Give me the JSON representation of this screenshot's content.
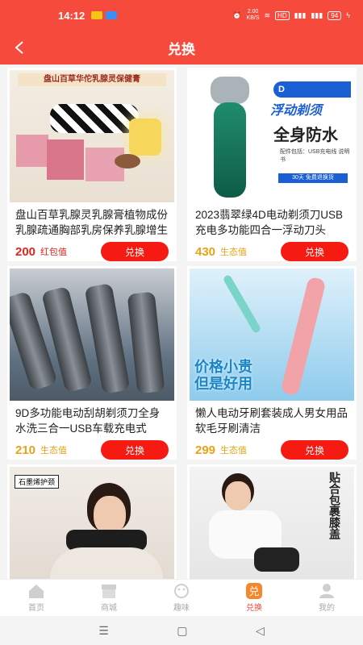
{
  "status": {
    "time": "14:12",
    "speed": "2.00\nKB/S",
    "battery": "94"
  },
  "header": {
    "title": "兑换"
  },
  "products": [
    {
      "name": "盘山百草乳腺灵乳腺膏植物成份乳腺疏通胸部乳房保养乳腺增生贴",
      "price": "200",
      "unit": "红包值",
      "price_color": "#e3251c",
      "button": "兑换"
    },
    {
      "name": "2023翡翠绿4D电动剃须刀USB充电多功能四合一浮动刀头",
      "price": "430",
      "unit": "生态值",
      "price_color": "#e8a317",
      "button": "兑换"
    },
    {
      "name": "9D多功能电动刮胡剃须刀全身水洗三合一USB车载充电式",
      "price": "210",
      "unit": "生态值",
      "price_color": "#e8a317",
      "button": "兑换"
    },
    {
      "name": "懒人电动牙刷套装成人男女用品软毛牙刷清洁",
      "price": "299",
      "unit": "生态值",
      "price_color": "#e8a317",
      "button": "兑换"
    }
  ],
  "images": {
    "p1_banner": "盘山百草华佗乳腺灵保健膏",
    "p2_tag": "D",
    "p2_headline": "浮动剃须",
    "p2_big": "全身防水",
    "p2_sub": "配件包括：USB充电线 说明书",
    "p2_free": "30天 免费退换货",
    "p4_text": "价格小贵\n但是好用",
    "p5_tag": "石墨烯护颈",
    "p6_text": "贴合包裹膝盖"
  },
  "tabs": [
    {
      "label": "首页",
      "icon": "home-icon"
    },
    {
      "label": "商城",
      "icon": "store-icon"
    },
    {
      "label": "趣味",
      "icon": "fun-icon"
    },
    {
      "label": "兑换",
      "icon": "exchange-icon"
    },
    {
      "label": "我的",
      "icon": "profile-icon"
    }
  ],
  "nav": {
    "menu": "☰",
    "home": "▢",
    "back": "◁"
  }
}
